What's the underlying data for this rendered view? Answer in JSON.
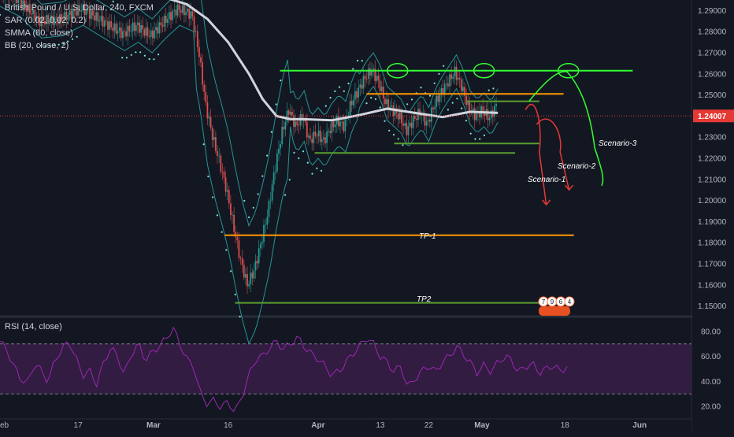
{
  "header": {
    "symbol_line": "British Pound / U.S. Dollar, 240, FXCM",
    "indicators": [
      "SAR (0.02, 0.02, 0.2)",
      "SMMA (80, close)",
      "BB (20, close, 2)"
    ]
  },
  "rsi": {
    "label": "RSI (14, close)",
    "ticks": [
      "80.00",
      "60.00",
      "40.00",
      "20.00"
    ],
    "upper": 70,
    "lower": 30
  },
  "price_axis": {
    "ticks": [
      "1.29000",
      "1.28000",
      "1.27000",
      "1.26000",
      "1.25000",
      "1.24000",
      "1.23000",
      "1.22000",
      "1.21000",
      "1.20000",
      "1.19000",
      "1.18000",
      "1.17000",
      "1.16000",
      "1.15000"
    ],
    "current_price": "1.24007"
  },
  "time_axis": {
    "labels": [
      "eb",
      "17",
      "Mar",
      "16",
      "Apr",
      "13",
      "22",
      "May",
      "18",
      "Jun"
    ]
  },
  "annotations": {
    "scenario_1": "Scenario-1",
    "scenario_2": "Scenario-2",
    "scenario_3": "Scenario-3",
    "tp1": "TP-1",
    "tp2": "TP2"
  },
  "badges": [
    "7",
    "9",
    "6",
    "4"
  ],
  "colors": {
    "background": "#131722",
    "candle_up": "#26a69a",
    "candle_down": "#ef5350",
    "smma": "#d1d4dc",
    "bb": "#2ab4b0",
    "sar": "#7fe8e0",
    "resistance": "#33ff33",
    "orange_level": "#ff9800",
    "support": "#5b9e2f",
    "rsi_line": "#9c27b0",
    "rsi_band": "#3d1f4d",
    "scenario_red": "#e53935",
    "scenario_green": "#33ff33",
    "price_label": "#e53935"
  },
  "chart_data": {
    "type": "candlestick",
    "pair": "British Pound / U.S. Dollar",
    "timeframe": "240",
    "source": "FXCM",
    "ylim": [
      1.145,
      1.295
    ],
    "rsi_ylim": [
      10,
      90
    ],
    "current_price": 1.24007,
    "levels": [
      {
        "name": "resistance",
        "price": 1.2615,
        "start": 0.405,
        "end": 0.915
      },
      {
        "name": "orange-resistance",
        "price": 1.2505,
        "start": 0.53,
        "end": 0.815
      },
      {
        "name": "green-short",
        "price": 1.247,
        "start": 0.675,
        "end": 0.78
      },
      {
        "name": "support-upper",
        "price": 1.227,
        "start": 0.57,
        "end": 0.78
      },
      {
        "name": "support-lower",
        "price": 1.2225,
        "start": 0.455,
        "end": 0.745
      },
      {
        "name": "TP-1",
        "price": 1.1835,
        "start": 0.325,
        "end": 0.83
      },
      {
        "name": "TP2",
        "price": 1.1515,
        "start": 0.34,
        "end": 0.79
      }
    ],
    "price_path": [
      [
        0.0,
        1.3
      ],
      [
        0.03,
        1.295
      ],
      [
        0.06,
        1.285
      ],
      [
        0.09,
        1.286
      ],
      [
        0.12,
        1.291
      ],
      [
        0.15,
        1.285
      ],
      [
        0.18,
        1.279
      ],
      [
        0.2,
        1.283
      ],
      [
        0.22,
        1.278
      ],
      [
        0.24,
        1.285
      ],
      [
        0.26,
        1.291
      ],
      [
        0.28,
        1.288
      ],
      [
        0.29,
        1.27
      ],
      [
        0.3,
        1.245
      ],
      [
        0.31,
        1.23
      ],
      [
        0.32,
        1.218
      ],
      [
        0.33,
        1.205
      ],
      [
        0.34,
        1.188
      ],
      [
        0.35,
        1.172
      ],
      [
        0.36,
        1.16
      ],
      [
        0.37,
        1.167
      ],
      [
        0.38,
        1.18
      ],
      [
        0.39,
        1.195
      ],
      [
        0.4,
        1.215
      ],
      [
        0.41,
        1.232
      ],
      [
        0.42,
        1.243
      ],
      [
        0.43,
        1.235
      ],
      [
        0.44,
        1.24
      ],
      [
        0.45,
        1.228
      ],
      [
        0.46,
        1.232
      ],
      [
        0.47,
        1.228
      ],
      [
        0.48,
        1.234
      ],
      [
        0.49,
        1.238
      ],
      [
        0.5,
        1.235
      ],
      [
        0.51,
        1.246
      ],
      [
        0.52,
        1.252
      ],
      [
        0.53,
        1.258
      ],
      [
        0.54,
        1.262
      ],
      [
        0.55,
        1.256
      ],
      [
        0.56,
        1.246
      ],
      [
        0.57,
        1.243
      ],
      [
        0.58,
        1.24
      ],
      [
        0.59,
        1.233
      ],
      [
        0.6,
        1.238
      ],
      [
        0.61,
        1.242
      ],
      [
        0.62,
        1.236
      ],
      [
        0.63,
        1.245
      ],
      [
        0.64,
        1.251
      ],
      [
        0.65,
        1.256
      ],
      [
        0.66,
        1.261
      ],
      [
        0.67,
        1.254
      ],
      [
        0.68,
        1.244
      ],
      [
        0.69,
        1.24
      ],
      [
        0.7,
        1.243
      ],
      [
        0.71,
        1.239
      ],
      [
        0.72,
        1.245
      ]
    ],
    "smma_path": [
      [
        0.0,
        1.298
      ],
      [
        0.2,
        1.297
      ],
      [
        0.24,
        1.296
      ],
      [
        0.27,
        1.293
      ],
      [
        0.3,
        1.286
      ],
      [
        0.33,
        1.275
      ],
      [
        0.36,
        1.26
      ],
      [
        0.38,
        1.248
      ],
      [
        0.4,
        1.24
      ],
      [
        0.42,
        1.2385
      ],
      [
        0.44,
        1.2385
      ],
      [
        0.48,
        1.238
      ],
      [
        0.52,
        1.2405
      ],
      [
        0.56,
        1.2435
      ],
      [
        0.6,
        1.2415
      ],
      [
        0.64,
        1.2395
      ],
      [
        0.68,
        1.242
      ],
      [
        0.72,
        1.2415
      ]
    ],
    "rsi_path": [
      [
        0.0,
        72
      ],
      [
        0.01,
        65
      ],
      [
        0.02,
        52
      ],
      [
        0.03,
        42
      ],
      [
        0.04,
        38
      ],
      [
        0.05,
        55
      ],
      [
        0.06,
        48
      ],
      [
        0.07,
        40
      ],
      [
        0.08,
        58
      ],
      [
        0.09,
        66
      ],
      [
        0.1,
        72
      ],
      [
        0.11,
        58
      ],
      [
        0.12,
        45
      ],
      [
        0.13,
        48
      ],
      [
        0.14,
        38
      ],
      [
        0.15,
        55
      ],
      [
        0.16,
        67
      ],
      [
        0.17,
        60
      ],
      [
        0.18,
        45
      ],
      [
        0.19,
        62
      ],
      [
        0.2,
        70
      ],
      [
        0.21,
        57
      ],
      [
        0.22,
        63
      ],
      [
        0.23,
        68
      ],
      [
        0.24,
        74
      ],
      [
        0.25,
        83
      ],
      [
        0.26,
        70
      ],
      [
        0.27,
        58
      ],
      [
        0.28,
        52
      ],
      [
        0.29,
        30
      ],
      [
        0.3,
        22
      ],
      [
        0.31,
        25
      ],
      [
        0.32,
        19
      ],
      [
        0.33,
        24
      ],
      [
        0.34,
        15
      ],
      [
        0.35,
        28
      ],
      [
        0.36,
        45
      ],
      [
        0.37,
        58
      ],
      [
        0.38,
        60
      ],
      [
        0.39,
        67
      ],
      [
        0.4,
        72
      ],
      [
        0.41,
        66
      ],
      [
        0.42,
        70
      ],
      [
        0.43,
        75
      ],
      [
        0.44,
        68
      ],
      [
        0.45,
        62
      ],
      [
        0.46,
        58
      ],
      [
        0.47,
        52
      ],
      [
        0.48,
        45
      ],
      [
        0.49,
        48
      ],
      [
        0.5,
        55
      ],
      [
        0.51,
        62
      ],
      [
        0.52,
        68
      ],
      [
        0.53,
        75
      ],
      [
        0.54,
        70
      ],
      [
        0.55,
        60
      ],
      [
        0.56,
        55
      ],
      [
        0.57,
        48
      ],
      [
        0.58,
        52
      ],
      [
        0.59,
        35
      ],
      [
        0.6,
        42
      ],
      [
        0.61,
        48
      ],
      [
        0.62,
        53
      ],
      [
        0.63,
        47
      ],
      [
        0.64,
        56
      ],
      [
        0.65,
        60
      ],
      [
        0.66,
        68
      ],
      [
        0.67,
        62
      ],
      [
        0.68,
        55
      ],
      [
        0.69,
        47
      ],
      [
        0.7,
        53
      ],
      [
        0.71,
        48
      ],
      [
        0.72,
        55
      ],
      [
        0.73,
        60
      ],
      [
        0.74,
        57
      ],
      [
        0.75,
        47
      ],
      [
        0.76,
        52
      ],
      [
        0.77,
        54
      ],
      [
        0.78,
        47
      ],
      [
        0.79,
        50
      ],
      [
        0.8,
        53
      ],
      [
        0.81,
        48
      ],
      [
        0.82,
        52
      ]
    ]
  }
}
